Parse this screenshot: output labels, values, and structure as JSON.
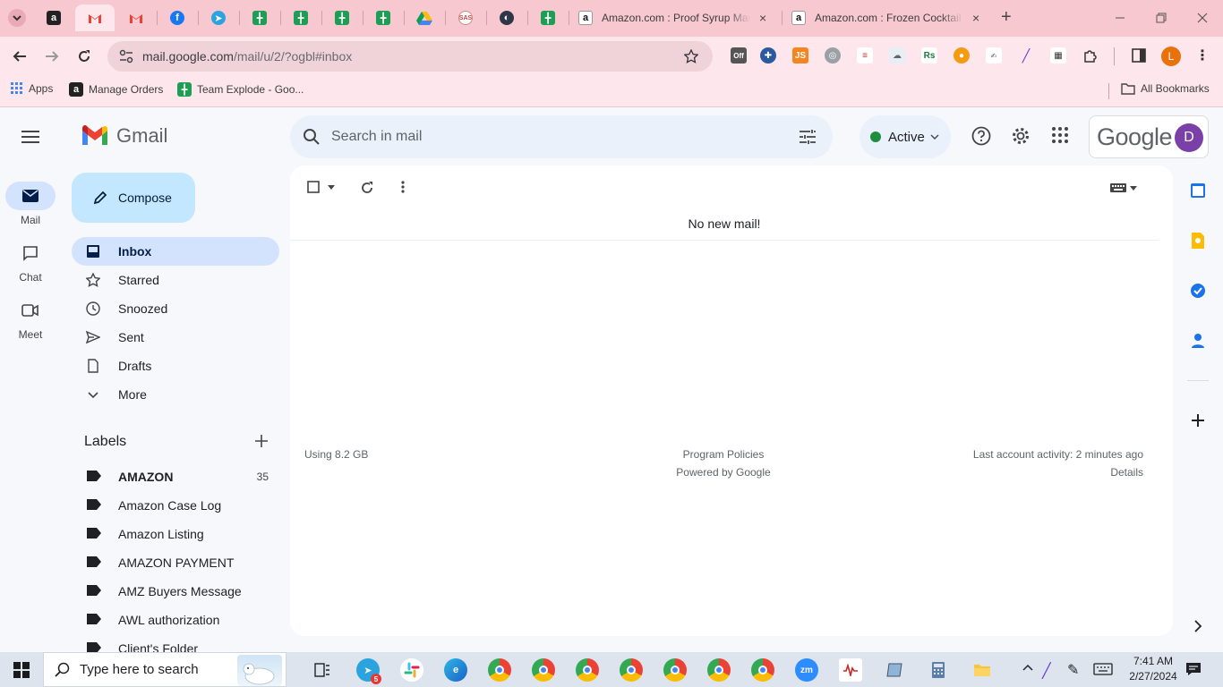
{
  "browser": {
    "tabs": [
      {
        "title": "Amazon.com : Proof Syrup Man",
        "close": "×"
      },
      {
        "title": "Amazon.com : Frozen Cocktail D",
        "close": "×"
      }
    ],
    "new_tab": "+",
    "address": {
      "host": "mail.google.com",
      "path": "/mail/u/2/?ogbl#inbox"
    },
    "bookmarks": {
      "apps": "Apps",
      "manage_orders": "Manage Orders",
      "team_explode": "Team Explode - Goo...",
      "all_bookmarks": "All Bookmarks"
    },
    "profile_initial": "L",
    "ext_off_label": "Off"
  },
  "gmail": {
    "product_name": "Gmail",
    "rail": {
      "mail": "Mail",
      "chat": "Chat",
      "meet": "Meet"
    },
    "compose": "Compose",
    "nav": [
      {
        "label": "Inbox"
      },
      {
        "label": "Starred"
      },
      {
        "label": "Snoozed"
      },
      {
        "label": "Sent"
      },
      {
        "label": "Drafts"
      },
      {
        "label": "More"
      }
    ],
    "labels_title": "Labels",
    "labels": [
      {
        "name": "AMAZON",
        "count": "35"
      },
      {
        "name": "Amazon Case Log"
      },
      {
        "name": "Amazon Listing"
      },
      {
        "name": "AMAZON PAYMENT"
      },
      {
        "name": "AMZ Buyers Message"
      },
      {
        "name": "AWL authorization"
      },
      {
        "name": "Client's Folder"
      }
    ],
    "search_placeholder": "Search in mail",
    "status": "Active",
    "account_brand": "Google",
    "account_initial": "D",
    "empty_message": "No new mail!",
    "footer": {
      "storage": "Using 8.2 GB",
      "policies": "Program Policies",
      "powered": "Powered by Google",
      "activity": "Last account activity: 2 minutes ago",
      "details": "Details"
    }
  },
  "taskbar": {
    "search_placeholder": "Type here to search",
    "time": "7:41 AM",
    "date": "2/27/2024",
    "telegram_badge": "5",
    "zoom_label": "zm"
  },
  "colors": {
    "tabstrip": "#f8c8d0",
    "toolbar": "#fde7ec",
    "gmail_bg": "#f6f8fc",
    "accent_blue": "#0b57d0",
    "active_green": "#1e8e3e"
  }
}
